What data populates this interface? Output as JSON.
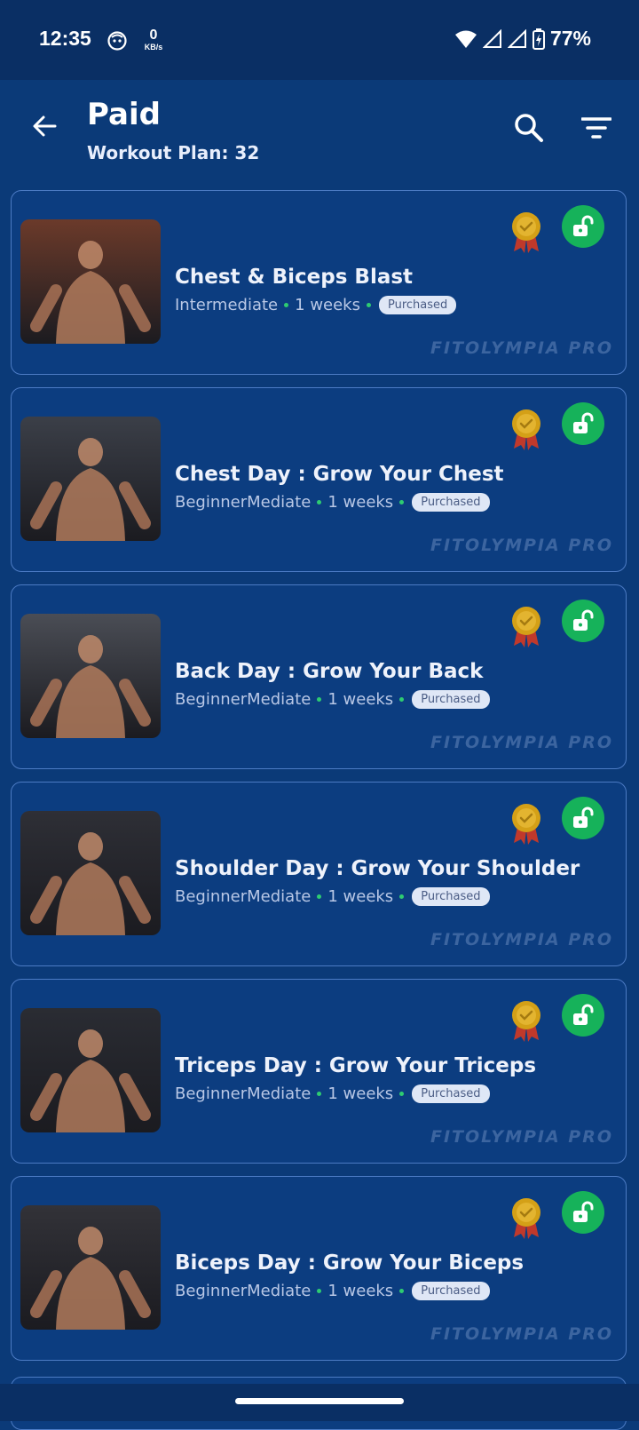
{
  "status_bar": {
    "time": "12:35",
    "net_speed_value": "0",
    "net_speed_unit": "KB/s",
    "battery": "77%"
  },
  "app_bar": {
    "title": "Paid",
    "subtitle": "Workout Plan: 32",
    "icons": [
      "arrow-back-icon",
      "search-icon",
      "filter-icon"
    ]
  },
  "watermark": "FITOLYMPIA PRO",
  "plans": [
    {
      "title": "Chest & Biceps Blast",
      "level": "Intermediate",
      "duration": "1 weeks",
      "badge": "Purchased",
      "thumb_color": "#6b3a2a"
    },
    {
      "title": "Chest Day : Grow Your Chest",
      "level": "BeginnerMediate",
      "duration": "1 weeks",
      "badge": "Purchased",
      "thumb_color": "#3b3f48"
    },
    {
      "title": "Back Day : Grow Your Back",
      "level": "BeginnerMediate",
      "duration": "1 weeks",
      "badge": "Purchased",
      "thumb_color": "#4a4d55"
    },
    {
      "title": "Shoulder Day : Grow Your Shoulder",
      "level": "BeginnerMediate",
      "duration": "1 weeks",
      "badge": "Purchased",
      "thumb_color": "#2e2f36"
    },
    {
      "title": "Triceps Day : Grow Your Triceps",
      "level": "BeginnerMediate",
      "duration": "1 weeks",
      "badge": "Purchased",
      "thumb_color": "#2a2c33"
    },
    {
      "title": "Biceps Day : Grow Your Biceps",
      "level": "BeginnerMediate",
      "duration": "1 weeks",
      "badge": "Purchased",
      "thumb_color": "#323238"
    }
  ],
  "colors": {
    "background": "#0b3a78",
    "card_border": "#4c7bc4",
    "unlock_green": "#16b25a",
    "medal_gold": "#d4a017",
    "badge_bg": "#dfe7f6"
  }
}
